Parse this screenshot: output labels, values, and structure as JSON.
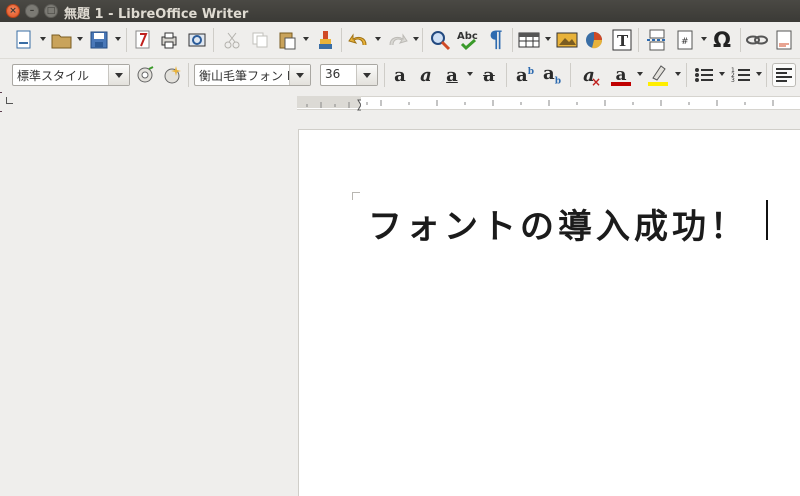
{
  "window": {
    "title": "無題 1 - LibreOffice Writer"
  },
  "format_toolbar": {
    "paragraph_style": "標準スタイル",
    "font_name": "衡山毛筆フォン I",
    "font_size": "36"
  },
  "icons": {
    "new_doc": "📄",
    "open": "📂",
    "save": "💾",
    "pdf": "⎙",
    "print": "🖶",
    "preview": "▣",
    "cut": "✂",
    "copy": "⧉",
    "paste": "📋",
    "format_brush": "🖌",
    "undo": "↶",
    "redo": "↷",
    "find": "🔍",
    "spell": "Abc",
    "pilcrow": "¶",
    "table": "▦",
    "image": "▨",
    "chart": "◔",
    "textbox": "T",
    "page_break": "⤓",
    "field": "▤",
    "special_char": "Ω",
    "link": "⛓",
    "footnote": "▯",
    "styles_update": "⚙",
    "styles_new": "✧",
    "bold": "a",
    "italic": "a",
    "underline": "a",
    "strike": "a",
    "superscript": "ab",
    "subscript": "ab",
    "clear_format": "a",
    "font_color": "A",
    "highlight": "✎",
    "bullets": "☰",
    "numbering": "☷",
    "align": "≡"
  },
  "document": {
    "text": "フォントの導入成功！"
  },
  "colors": {
    "accent_close": "#e0521f",
    "highlight_yellow": "#ffee00",
    "font_red": "#c00000"
  }
}
